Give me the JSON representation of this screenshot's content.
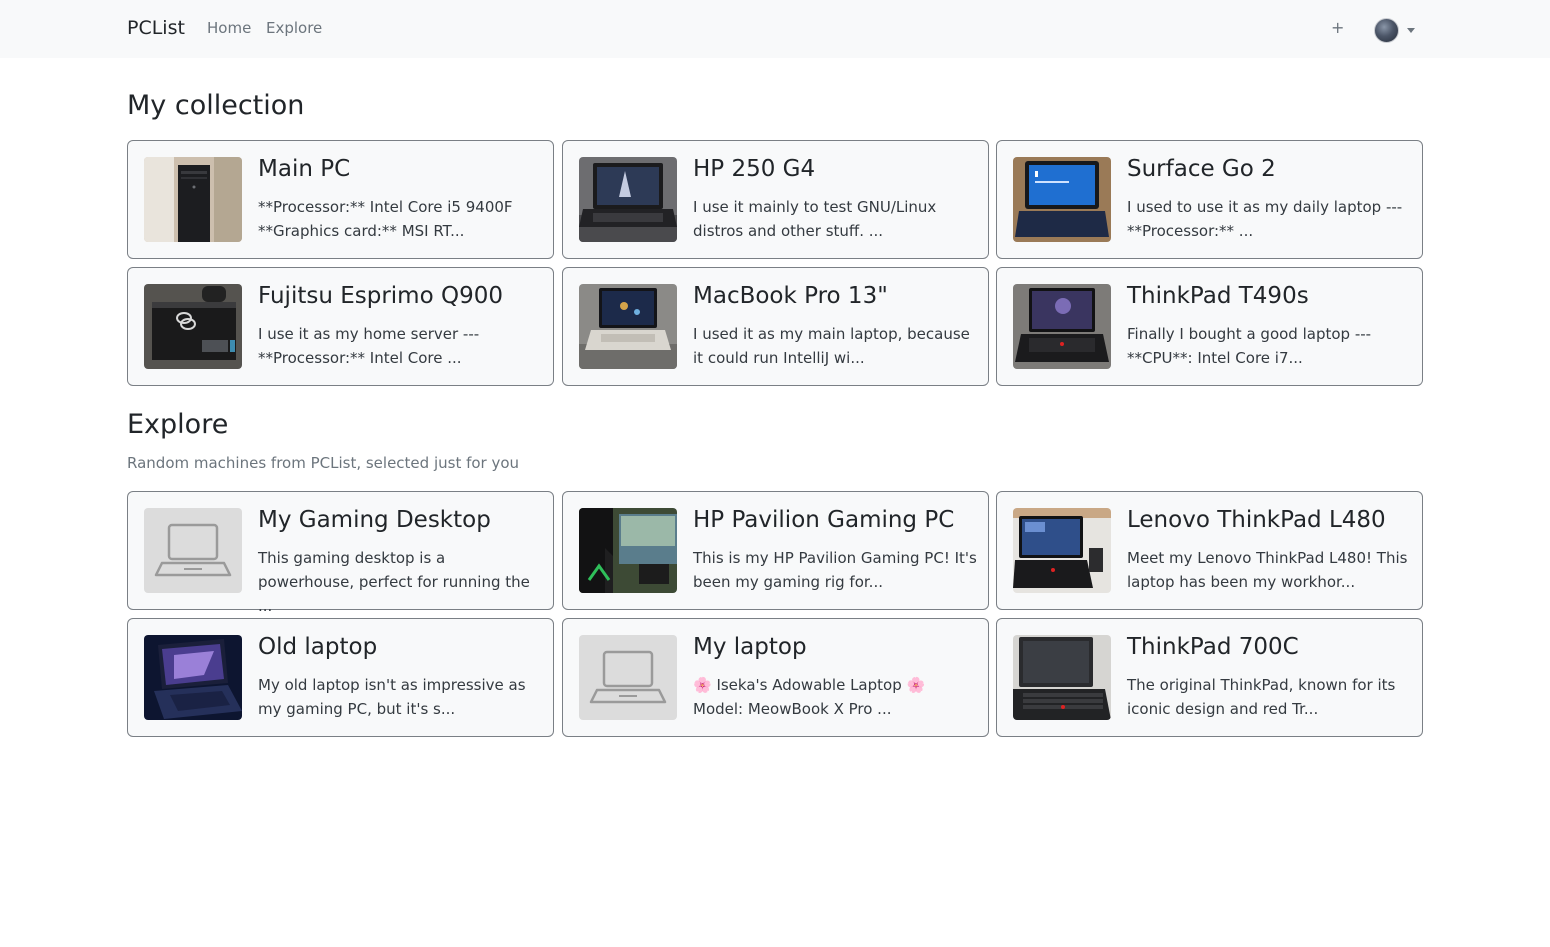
{
  "navbar": {
    "brand": "PCList",
    "links": [
      "Home",
      "Explore"
    ],
    "add_label": "+"
  },
  "collection": {
    "title": "My collection",
    "cards": [
      {
        "title": "Main PC",
        "desc": "**Processor:** Intel Core i5 9400F **Graphics card:** MSI RT..."
      },
      {
        "title": "HP 250 G4",
        "desc": "I use it mainly to test GNU/Linux distros and other stuff. ..."
      },
      {
        "title": "Surface Go 2",
        "desc": "I used to use it as my daily laptop --- **Processor:** ..."
      },
      {
        "title": "Fujitsu Esprimo Q900",
        "desc": "I use it as my home server --- **Processor:** Intel Core ..."
      },
      {
        "title": "MacBook Pro 13\"",
        "desc": "I used it as my main laptop, because it could run IntelliJ wi..."
      },
      {
        "title": "ThinkPad T490s",
        "desc": "Finally I bought a good laptop --- **CPU**: Intel Core i7..."
      }
    ]
  },
  "explore": {
    "title": "Explore",
    "subtitle": "Random machines from PCList, selected just for you",
    "cards": [
      {
        "title": "My Gaming Desktop",
        "desc": "This gaming desktop is a powerhouse, perfect for running the ..."
      },
      {
        "title": "HP Pavilion Gaming PC",
        "desc": "This is my HP Pavilion Gaming PC! It's been my gaming rig for..."
      },
      {
        "title": "Lenovo ThinkPad L480",
        "desc": "Meet my Lenovo ThinkPad L480! This laptop has been my workhor..."
      },
      {
        "title": "Old laptop",
        "desc": "My old laptop isn't as impressive as my gaming PC, but it's s..."
      },
      {
        "title": "My laptop",
        "desc": "🌸 Iseka's Adowable Laptop 🌸 Model: MeowBook X Pro ..."
      },
      {
        "title": "ThinkPad 700C",
        "desc": "The original ThinkPad, known for its iconic design and red Tr..."
      }
    ]
  }
}
